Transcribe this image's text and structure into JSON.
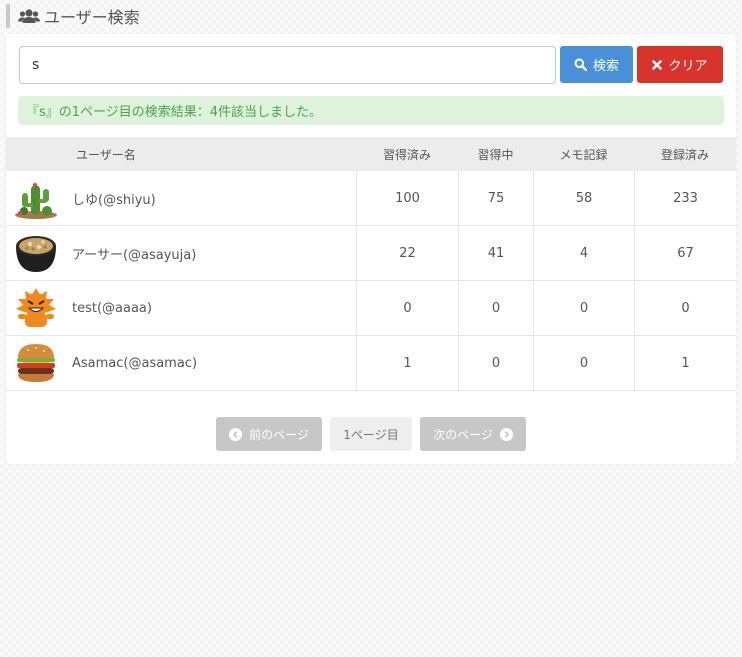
{
  "header": {
    "title": "ユーザー検索",
    "icon": "users-icon"
  },
  "search": {
    "value": "s",
    "search_button": "検索",
    "clear_button": "クリア"
  },
  "alert": {
    "message": "『s』の1ページ目の検索結果：4件該当しました。"
  },
  "table": {
    "columns": [
      "ユーザー名",
      "習得済み",
      "習得中",
      "メモ記録",
      "登録済み"
    ],
    "rows": [
      {
        "name": "しゆ(@shiyu)",
        "avatar": "cactus-avatar",
        "learned": "100",
        "learning": "75",
        "memo": "58",
        "registered": "233"
      },
      {
        "name": "アーサー(@asayuja)",
        "avatar": "miso-soup-avatar",
        "learned": "22",
        "learning": "41",
        "memo": "4",
        "registered": "67"
      },
      {
        "name": "test(@aaaa)",
        "avatar": "orange-monster-avatar",
        "learned": "0",
        "learning": "0",
        "memo": "0",
        "registered": "0"
      },
      {
        "name": "Asamac(@asamac)",
        "avatar": "hamburger-avatar",
        "learned": "1",
        "learning": "0",
        "memo": "0",
        "registered": "1"
      }
    ]
  },
  "pager": {
    "prev": "前のページ",
    "current": "1ページ目",
    "next": "次のページ"
  },
  "colors": {
    "primary": "#4a90d9",
    "danger": "#d9342b",
    "success_bg": "#dff3dc",
    "success_text": "#4aa44a"
  }
}
